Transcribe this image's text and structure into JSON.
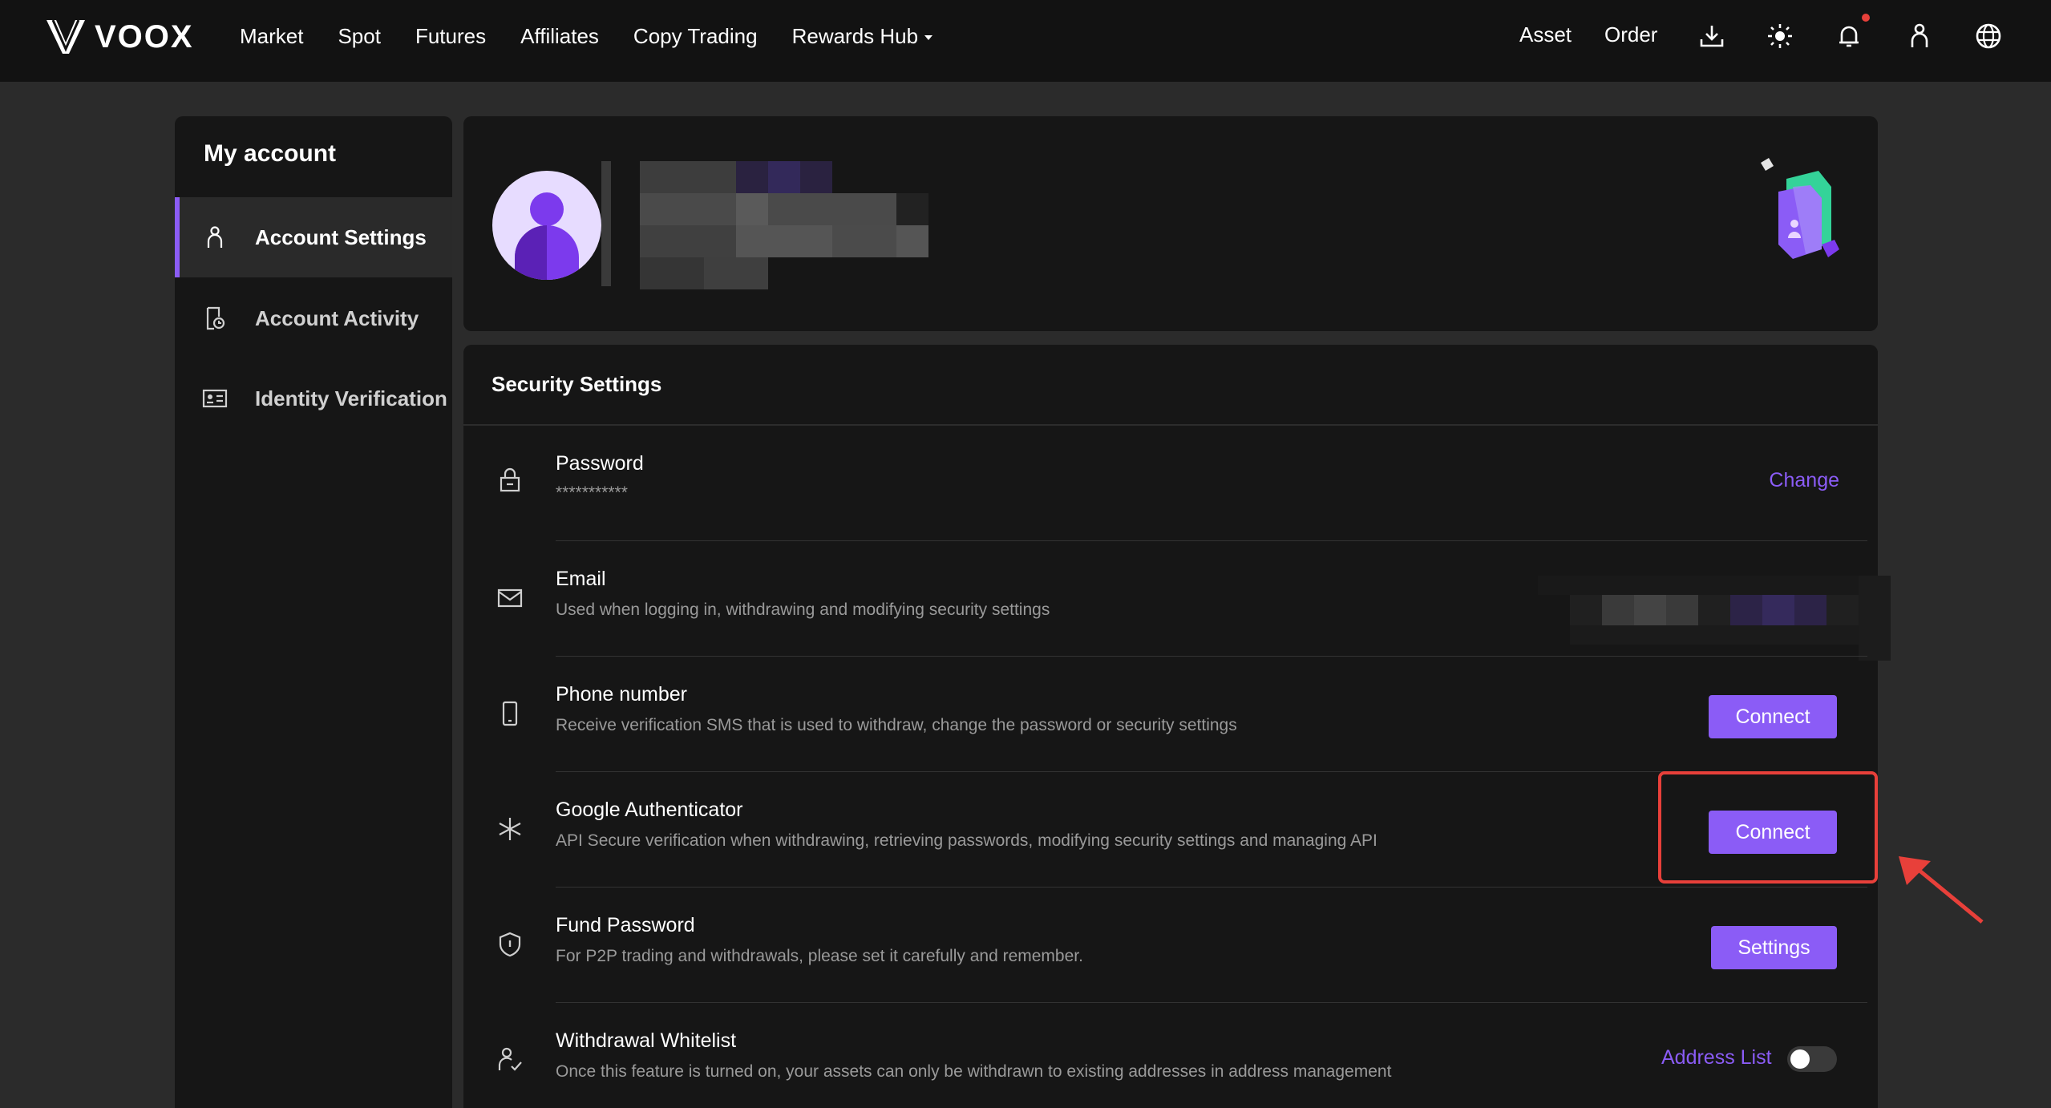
{
  "brand": {
    "name": "VOOX",
    "accent": "#8b5cf6"
  },
  "nav": {
    "items": [
      {
        "label": "Market"
      },
      {
        "label": "Spot"
      },
      {
        "label": "Futures"
      },
      {
        "label": "Affiliates"
      },
      {
        "label": "Copy Trading"
      },
      {
        "label": "Rewards Hub"
      }
    ],
    "right": {
      "asset": "Asset",
      "order": "Order"
    },
    "icons": [
      "download-icon",
      "theme-sun-icon",
      "bell-icon",
      "user-icon",
      "globe-icon"
    ]
  },
  "sidebar": {
    "title": "My account",
    "items": [
      {
        "label": "Account Settings",
        "icon": "user-icon",
        "active": true
      },
      {
        "label": "Account Activity",
        "icon": "activity-icon",
        "active": false
      },
      {
        "label": "Identity Verification",
        "icon": "id-card-icon",
        "active": false
      }
    ]
  },
  "security": {
    "title": "Security Settings",
    "rows": [
      {
        "title": "Password",
        "desc": "***********",
        "action": "Change",
        "icon": "lock-icon"
      },
      {
        "title": "Email",
        "desc": "Used when logging in, withdrawing and modifying security settings",
        "action": "",
        "icon": "mail-icon"
      },
      {
        "title": "Phone number",
        "desc": "Receive verification SMS that is used to withdraw, change the password or security settings",
        "action": "Connect",
        "icon": "phone-icon"
      },
      {
        "title": "Google Authenticator",
        "desc": "API Secure verification when withdrawing, retrieving passwords, modifying security settings and managing API",
        "action": "Connect",
        "icon": "authenticator-icon"
      },
      {
        "title": "Fund Password",
        "desc": "For P2P trading and withdrawals, please set it carefully and remember.",
        "action": "Settings",
        "icon": "shield-icon"
      },
      {
        "title": "Withdrawal Whitelist",
        "desc": "Once this feature is turned on, your assets can only be withdrawn to existing addresses in address management",
        "action": "Address List",
        "icon": "whitelist-icon",
        "toggle": false
      }
    ]
  }
}
